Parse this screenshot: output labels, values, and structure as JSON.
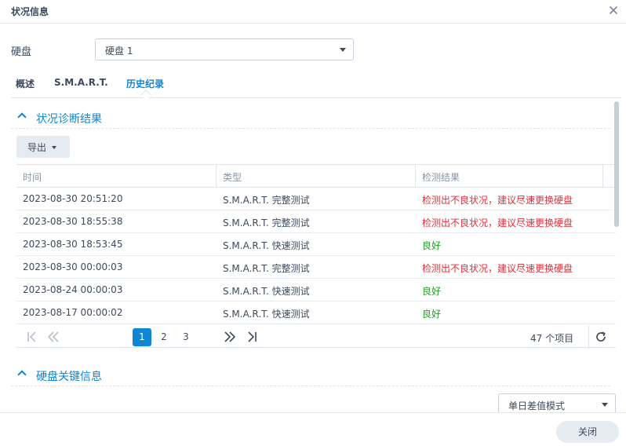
{
  "window": {
    "title": "状况信息"
  },
  "disk": {
    "label": "硬盘",
    "selected": "硬盘 1"
  },
  "tabs": [
    {
      "label": "概述",
      "active": false
    },
    {
      "label": "S.M.A.R.T.",
      "active": false
    },
    {
      "label": "历史纪录",
      "active": true
    }
  ],
  "diagnosis": {
    "title": "状况诊断结果",
    "export_label": "导出",
    "columns": [
      "时间",
      "类型",
      "检测结果"
    ],
    "rows": [
      {
        "time": "2023-08-30 20:51:20",
        "type": "S.M.A.R.T. 完整测试",
        "result": "检测出不良状况，建议尽速更换硬盘",
        "status": "bad"
      },
      {
        "time": "2023-08-30 18:55:38",
        "type": "S.M.A.R.T. 完整测试",
        "result": "检测出不良状况，建议尽速更换硬盘",
        "status": "bad"
      },
      {
        "time": "2023-08-30 18:53:45",
        "type": "S.M.A.R.T. 快速测试",
        "result": "良好",
        "status": "ok"
      },
      {
        "time": "2023-08-30 00:00:03",
        "type": "S.M.A.R.T. 完整测试",
        "result": "检测出不良状况，建议尽速更换硬盘",
        "status": "bad"
      },
      {
        "time": "2023-08-24 00:00:03",
        "type": "S.M.A.R.T. 快速测试",
        "result": "良好",
        "status": "ok"
      },
      {
        "time": "2023-08-17 00:00:02",
        "type": "S.M.A.R.T. 快速测试",
        "result": "良好",
        "status": "ok"
      }
    ],
    "pager": {
      "pages": [
        "1",
        "2",
        "3"
      ],
      "current": "1",
      "count_text": "47 个项目"
    }
  },
  "key_info": {
    "title": "硬盘关键信息",
    "mode_selected": "单日差值模式"
  },
  "footer": {
    "close_label": "关闭"
  },
  "colors": {
    "accent": "#0e86d4",
    "bad": "#e1313c",
    "ok": "#24a028"
  },
  "icons": [
    "close-icon",
    "chevron-up-icon",
    "first-page-icon",
    "prev-page-icon",
    "next-page-icon",
    "last-page-icon",
    "refresh-icon"
  ]
}
